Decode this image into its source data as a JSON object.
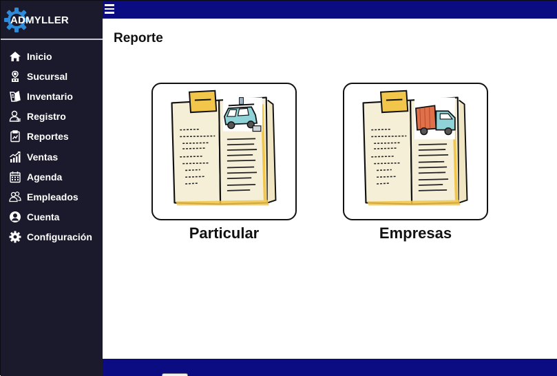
{
  "app": {
    "brand": "ADMYLLER",
    "colors": {
      "sidebar": "#1a1a2c",
      "topbar": "#0c0c82",
      "accent_gear": "#2d8bd9",
      "page_bg": "#ffffff"
    }
  },
  "sidebar": {
    "items": [
      {
        "label": "Inicio",
        "icon": "home-icon"
      },
      {
        "label": "Sucursal",
        "icon": "branch-icon"
      },
      {
        "label": "Inventario",
        "icon": "inventory-icon"
      },
      {
        "label": "Registro",
        "icon": "user-register-icon"
      },
      {
        "label": "Reportes",
        "icon": "report-icon"
      },
      {
        "label": "Ventas",
        "icon": "sales-chart-icon"
      },
      {
        "label": "Agenda",
        "icon": "calendar-icon"
      },
      {
        "label": "Empleados",
        "icon": "employees-icon"
      },
      {
        "label": "Cuenta",
        "icon": "account-icon"
      },
      {
        "label": "Configuración",
        "icon": "gear-icon"
      }
    ]
  },
  "topbar": {
    "menu_icon": "hamburger-icon"
  },
  "main": {
    "title": "Reporte",
    "options": [
      {
        "label": "Particular",
        "icon": "report-book-car-icon"
      },
      {
        "label": "Empresas",
        "icon": "report-book-truck-icon"
      }
    ]
  }
}
